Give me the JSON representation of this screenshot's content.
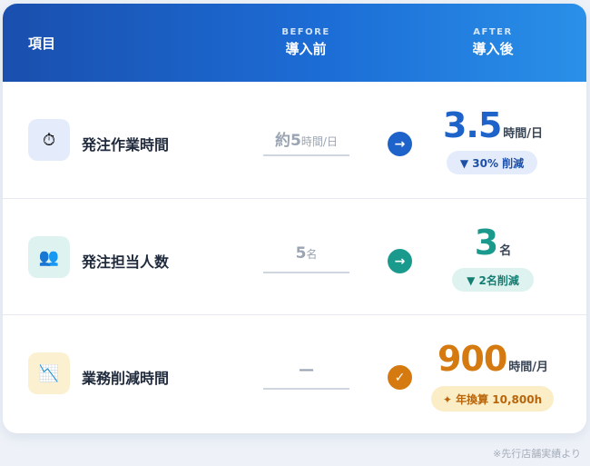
{
  "header": {
    "item_label": "項目",
    "before_en": "BEFORE",
    "before_jp": "導入前",
    "after_en": "AFTER",
    "after_jp": "導入後"
  },
  "rows": [
    {
      "icon": "stopwatch-icon",
      "icon_glyph": "⏱",
      "label": "発注作業時間",
      "before_main": "約5",
      "before_unit": "時間/日",
      "indicator": "→",
      "after_num": "3.5",
      "after_unit": "時間/日",
      "badge": "▼ 30% 削減",
      "accent": "#1e63c9"
    },
    {
      "icon": "people-icon",
      "icon_glyph": "👥",
      "label": "発注担当人数",
      "before_main": "5",
      "before_unit": "名",
      "indicator": "→",
      "after_num": "3",
      "after_unit": "名",
      "badge": "▼ 2名削減",
      "accent": "#199a8d"
    },
    {
      "icon": "chart-down-icon",
      "icon_glyph": "📉",
      "label": "業務削減時間",
      "before_main": "—",
      "before_unit": "",
      "indicator": "✓",
      "after_num": "900",
      "after_unit": "時間/月",
      "badge": "✦ 年換算 10,800h",
      "accent": "#d47a10"
    }
  ],
  "footnote": "※先行店舗実績より"
}
